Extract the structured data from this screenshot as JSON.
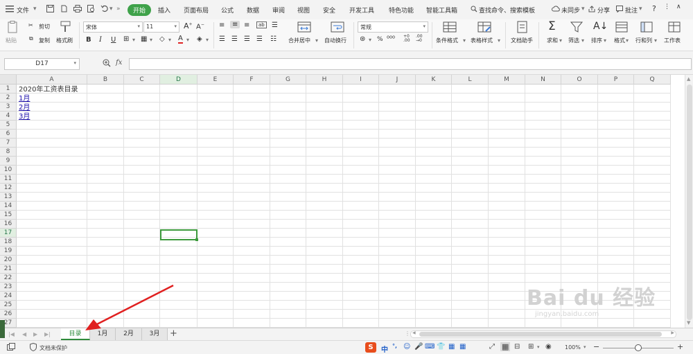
{
  "menu": {
    "file_label": "文件",
    "tabs": [
      "开始",
      "插入",
      "页面布局",
      "公式",
      "数据",
      "审阅",
      "视图",
      "安全",
      "开发工具",
      "特色功能",
      "智能工具箱"
    ],
    "search_label": "查找命令、搜索模板",
    "sync_label": "未同步",
    "share_label": "分享",
    "comment_label": "批注"
  },
  "ribbon": {
    "paste_label": "粘贴",
    "cut_label": "剪切",
    "copy_label": "复制",
    "format_painter_label": "格式刷",
    "font_name": "宋体",
    "font_size": "11",
    "merge_center_label": "合并居中",
    "wrap_text_label": "自动换行",
    "number_format": "常规",
    "conditional_format_label": "条件格式",
    "table_style_label": "表格样式",
    "doc_assistant_label": "文档助手",
    "sum_label": "求和",
    "filter_label": "筛选",
    "sort_label": "排序",
    "format_label": "格式",
    "row_col_label": "行和列",
    "worksheet_label": "工作表"
  },
  "formula_bar": {
    "name_box": "D17",
    "fx_label": "fx",
    "value": ""
  },
  "grid": {
    "columns": [
      "A",
      "B",
      "C",
      "D",
      "E",
      "F",
      "G",
      "H",
      "I",
      "J",
      "K",
      "L",
      "M",
      "N",
      "O",
      "P",
      "Q"
    ],
    "rows": [
      "1",
      "2",
      "3",
      "4",
      "5",
      "6",
      "7",
      "8",
      "9",
      "10",
      "11",
      "12",
      "13",
      "14",
      "15",
      "16",
      "17",
      "18",
      "19",
      "20",
      "21",
      "22",
      "23",
      "24",
      "25",
      "26",
      "27"
    ],
    "cells": {
      "A1": "2020年工资表目录",
      "A2": "1月",
      "A3": "2月",
      "A4": "3月"
    },
    "active_cell": "D17"
  },
  "sheet_tabs": [
    "目录",
    "1月",
    "2月",
    "3月"
  ],
  "add_sheet_label": "+",
  "status": {
    "protect_label": "文档未保护",
    "ime_label": "中",
    "zoom": "100%"
  },
  "watermark": {
    "main": "Bai du 经验",
    "sub": "jingyan.baidu.com"
  },
  "colors": {
    "accent": "#3fa24a",
    "active_cell_border": "#3c9a3c",
    "link": "#1a0dab",
    "annotation_arrow": "#e02020"
  }
}
